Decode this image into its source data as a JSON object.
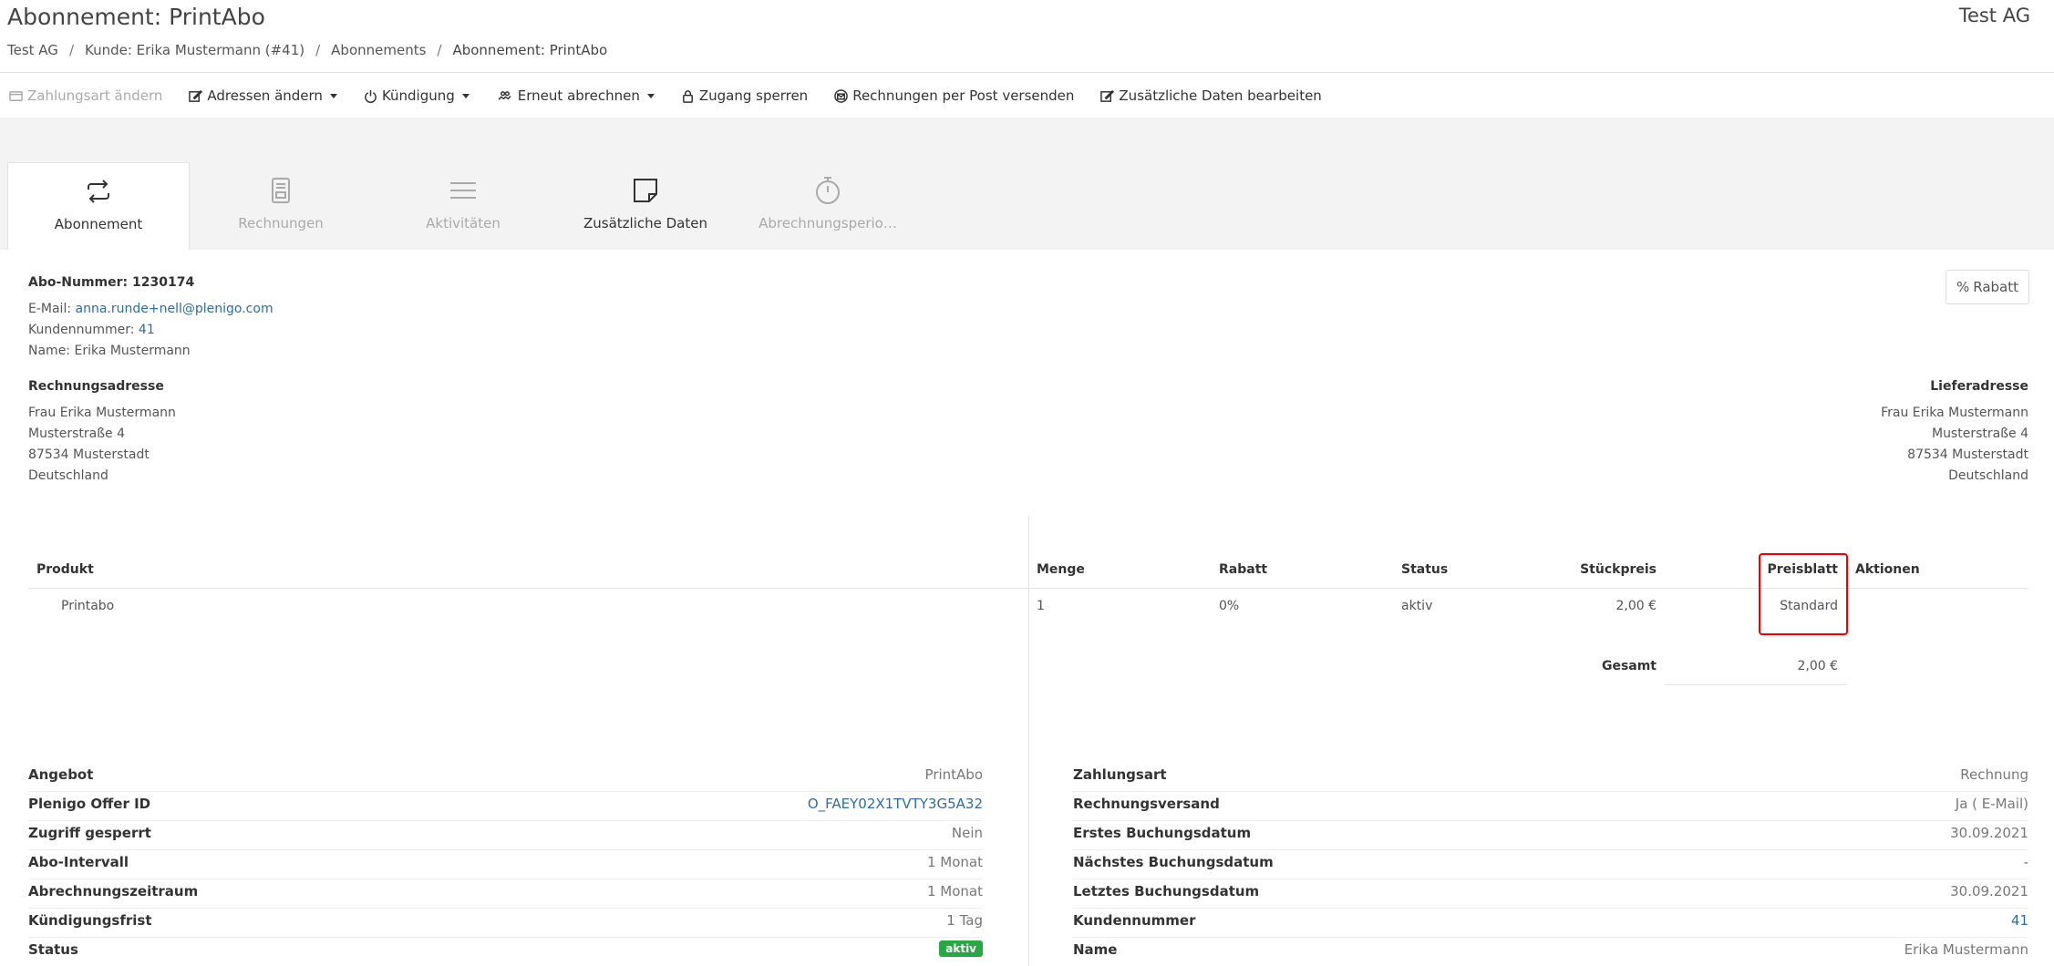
{
  "header": {
    "title": "Abonnement: PrintAbo",
    "org": "Test AG",
    "breadcrumb": [
      "Test AG",
      "Kunde: Erika Mustermann (#41)",
      "Abonnements",
      "Abonnement: PrintAbo"
    ]
  },
  "toolbar": {
    "payment": "Zahlungsart ändern",
    "addresses": "Adressen ändern",
    "cancel": "Kündigung",
    "rebill": "Erneut abrechnen",
    "lock": "Zugang sperren",
    "post": "Rechnungen per Post versenden",
    "extra": "Zusätzliche Daten bearbeiten"
  },
  "tabs": [
    "Abonnement",
    "Rechnungen",
    "Aktivitäten",
    "Zusätzliche Daten",
    "Abrechnungsperio…"
  ],
  "customer": {
    "abo_label": "Abo-Nummer:",
    "abo_number": "1230174",
    "email_label": "E-Mail:",
    "email": "anna.runde+nell@plenigo.com",
    "kdnr_label": "Kundennummer:",
    "kdnr": "41",
    "name_line": "Name: Erika Mustermann",
    "rabatt_button": "Rabatt"
  },
  "billing": {
    "title": "Rechnungsadresse",
    "lines": [
      "Frau Erika Mustermann",
      "Musterstraße 4",
      "87534 Musterstadt",
      "Deutschland"
    ]
  },
  "delivery": {
    "title": "Lieferadresse",
    "lines": [
      "Frau Erika Mustermann",
      "Musterstraße 4",
      "87534 Musterstadt",
      "Deutschland"
    ]
  },
  "products": {
    "headers": [
      "Produkt",
      "Menge",
      "Rabatt",
      "Status",
      "Stückpreis",
      "Preisblatt",
      "Aktionen"
    ],
    "row": [
      "Printabo",
      "1",
      "0%",
      "aktiv",
      "2,00 €",
      "Standard",
      ""
    ],
    "total_label": "Gesamt",
    "total_value": "2,00 €"
  },
  "details_left": [
    {
      "k": "Angebot",
      "v": "PrintAbo"
    },
    {
      "k": "Plenigo Offer ID",
      "v": "O_FAEY02X1TVTY3G5A32"
    },
    {
      "k": "Zugriff gesperrt",
      "v": "Nein"
    },
    {
      "k": "Abo-Intervall",
      "v": "1 Monat"
    },
    {
      "k": "Abrechnungszeitraum",
      "v": "1 Monat"
    },
    {
      "k": "Kündigungsfrist",
      "v": "1 Tag"
    },
    {
      "k": "Status",
      "v": "aktiv"
    }
  ],
  "details_right": [
    {
      "k": "Zahlungsart",
      "v": "Rechnung"
    },
    {
      "k": "Rechnungsversand",
      "v": "Ja ( E-Mail)"
    },
    {
      "k": "Erstes Buchungsdatum",
      "v": "30.09.2021"
    },
    {
      "k": "Nächstes Buchungsdatum",
      "v": "-"
    },
    {
      "k": "Letztes Buchungsdatum",
      "v": "30.09.2021"
    },
    {
      "k": "Kundennummer",
      "v": "41"
    },
    {
      "k": "Name",
      "v": "Erika Mustermann"
    }
  ],
  "colors": {
    "link": "#2e6da4",
    "badge": "#28a745",
    "highlight": "#ee0000"
  }
}
